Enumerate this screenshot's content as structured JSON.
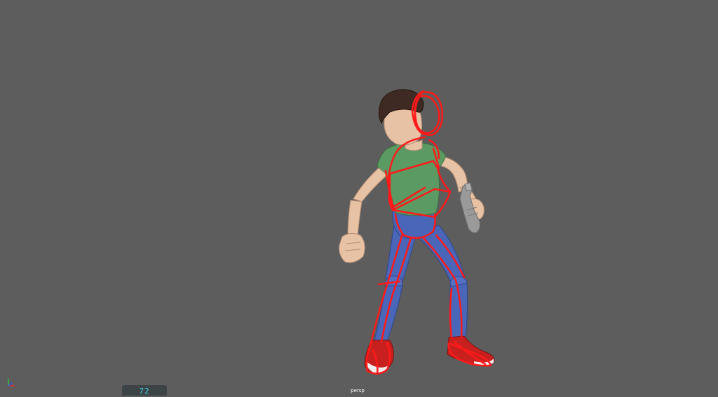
{
  "viewport": {
    "camera_label": "persp",
    "frame_counter": "72",
    "background_color": "#5d5d5d"
  },
  "scene": {
    "character": {
      "shirt_color": "#5b9a62",
      "pants_color": "#4a66b8",
      "skin_color": "#e8c2a4",
      "hair_color": "#3e2a22",
      "shoe_color": "#c8201e",
      "prop": "handheld-device-prop"
    },
    "overlay_sketch": {
      "stroke_color": "#ff1a1a",
      "strokes": [
        "head-circle",
        "torso-box",
        "spine-line",
        "left-leg-lines",
        "right-leg-lines"
      ]
    }
  },
  "axis_gizmo": {
    "x_color": "#e03030",
    "y_color": "#30c040",
    "z_color": "#3050ff"
  }
}
